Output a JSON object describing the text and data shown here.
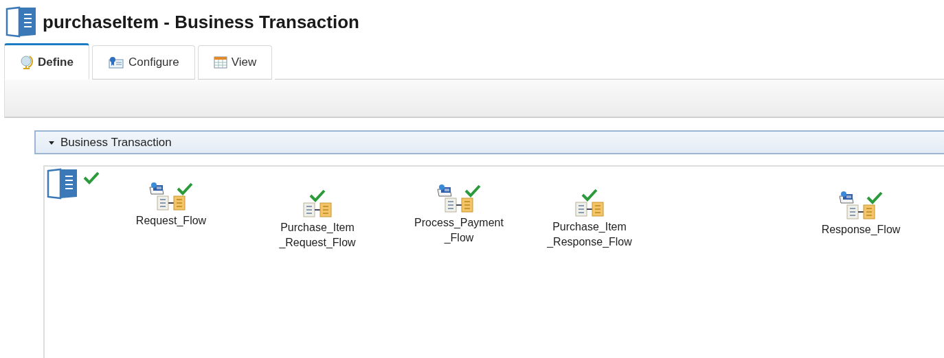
{
  "header": {
    "title": "purchaseItem - Business Transaction"
  },
  "tabs": [
    {
      "label": "Define",
      "selected": true
    },
    {
      "label": "Configure",
      "selected": false
    },
    {
      "label": "View",
      "selected": false
    }
  ],
  "section": {
    "title": "Business Transaction",
    "expanded": true
  },
  "diagram": {
    "root": {
      "valid": true
    },
    "nodes": [
      {
        "label_lines": [
          "Request_Flow"
        ],
        "configured": true,
        "valid": true
      },
      {
        "label_lines": [
          "Purchase_Item",
          "_Request_Flow"
        ],
        "configured": false,
        "valid": true
      },
      {
        "label_lines": [
          "Process_Payment",
          "_Flow"
        ],
        "configured": true,
        "valid": true
      },
      {
        "label_lines": [
          "Purchase_Item",
          "_Response_Flow"
        ],
        "configured": false,
        "valid": true
      },
      {
        "label_lines": [
          "Response_Flow"
        ],
        "configured": true,
        "valid": true
      }
    ]
  }
}
